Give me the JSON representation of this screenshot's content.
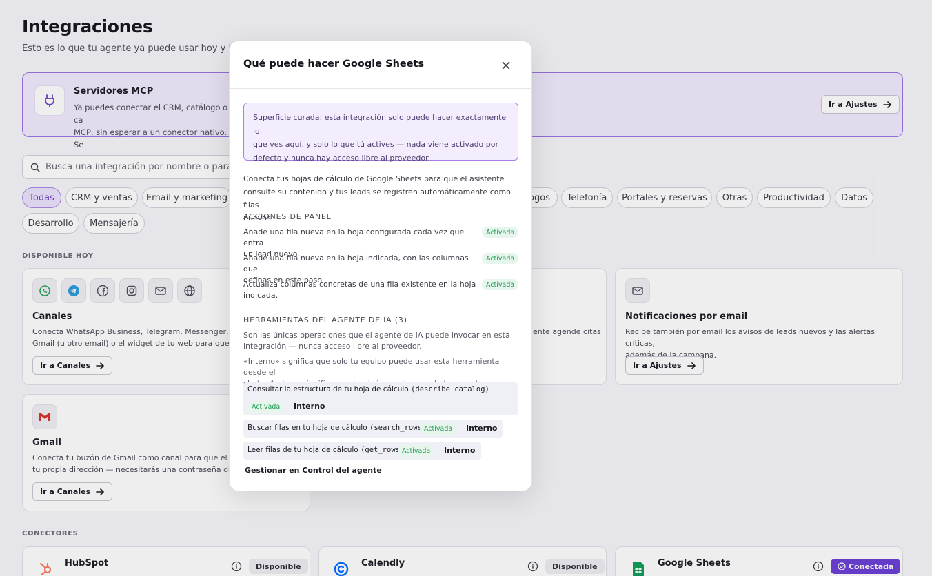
{
  "page": {
    "title": "Integraciones",
    "subtitle": "Esto es lo que tu agente ya puede usar hoy y lo que"
  },
  "mcp": {
    "title": "Servidores MCP",
    "desc_line1": "Ya puedes conectar el CRM, catálogo o ca",
    "desc_line2": "MCP, sin esperar a un conector nativo. Se",
    "button": "Ir a Ajustes"
  },
  "search": {
    "placeholder": "Busca una integración por nombre o para qu"
  },
  "filters": [
    "Todas",
    "CRM y ventas",
    "Email y marketing",
    "ogos",
    "Telefonía",
    "Portales y reservas",
    "Otras",
    "Productividad",
    "Datos",
    "Desarrollo",
    "Mensajería"
  ],
  "sections": {
    "available": "DISPONIBLE HOY",
    "connectors": "CONECTORES"
  },
  "cards": {
    "channels": {
      "title": "Canales",
      "desc_line1": "Conecta WhatsApp Business, Telegram, Messenger, Insta",
      "desc_line2": "Gmail (u otro email) o el widget de tu web para que el age",
      "button": "Ir a Canales"
    },
    "middle": {
      "desc_line1": "ente agende citas"
    },
    "email": {
      "title": "Notificaciones por email",
      "desc_line1": "Recibe también por email los avisos de leads nuevos y las alertas críticas,",
      "desc_line2": "además de la campana.",
      "button": "Ir a Ajustes"
    },
    "gmail": {
      "title": "Gmail",
      "desc_line1": "Conecta tu buzón de Gmail como canal para que el asiste",
      "desc_line2": "tu propia dirección — necesitarás una contraseña de aplic",
      "button": "Ir a Canales"
    },
    "hubspot": {
      "title": "HubSpot",
      "status": "Disponible"
    },
    "calendly": {
      "title": "Calendly",
      "status": "Disponible"
    },
    "sheets": {
      "title": "Google Sheets",
      "status": "Conectada"
    }
  },
  "modal": {
    "title": "Qué puede hacer Google Sheets",
    "notice_line1": "Superficie curada: esta integración solo puede hacer exactamente lo",
    "notice_line2": "que ves aquí, y solo lo que tú actives — nada viene activado por",
    "notice_line3": "defecto y nunca hay acceso libre al proveedor.",
    "intro_line1": "Conecta tus hojas de cálculo de Google Sheets para que el asistente",
    "intro_line2": "consulte su contenido y tus leads se registren automáticamente como filas",
    "intro_line3": "nuevas.",
    "panel_heading": "ACCIONES DE PANEL",
    "actions": [
      {
        "line1": "Añade una fila nueva en la hoja configurada cada vez que entra",
        "line2": "un lead nuevo.",
        "status": "Activada"
      },
      {
        "line1": "Añade una fila nueva en la hoja indicada, con las columnas que",
        "line2": "definas en este paso.",
        "status": "Activada"
      },
      {
        "line1": "Actualiza columnas concretas de una fila existente en la hoja",
        "line2": "indicada.",
        "status": "Activada"
      }
    ],
    "tools_heading": "HERRAMIENTAS DEL AGENTE DE IA (3)",
    "tools_desc_line1": "Son las únicas operaciones que el agente de IA puede invocar en esta",
    "tools_desc_line2": "integración — nunca acceso libre al proveedor.",
    "scope_desc_line1": "«Interno» significa que solo tu equipo puede usar esta herramienta desde el",
    "scope_desc_line2": "chat; «Ambos» significa que también pueden usarla tus clientes.",
    "tools": [
      {
        "name": "Consultar la estructura de tu hoja de cálculo",
        "code": "(describe_catalog)",
        "status": "Activada",
        "scope": "Interno"
      },
      {
        "name": "Buscar filas en tu hoja de cálculo",
        "code": "(search_rows)",
        "status": "Activada",
        "scope": "Interno"
      },
      {
        "name": "Leer filas de tu hoja de cálculo",
        "code": "(get_rows)",
        "status": "Activada",
        "scope": "Interno"
      }
    ],
    "manage_link": "Gestionar en Control del agente"
  }
}
